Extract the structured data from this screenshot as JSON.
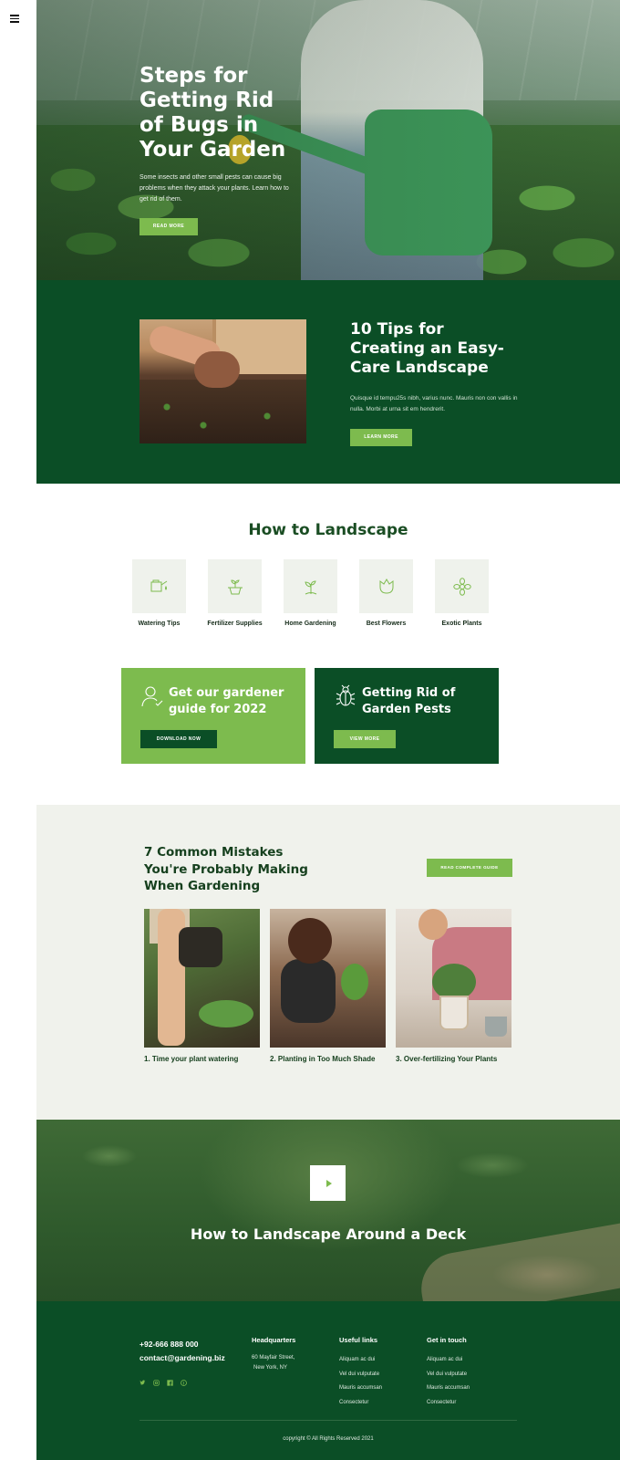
{
  "hero": {
    "title": "Steps for Getting Rid of Bugs in Your Garden",
    "text": "Some insects and other small pests can cause big problems when they attack your plants. Learn how to get rid of them.",
    "button": "READ MORE"
  },
  "tips": {
    "title": "10 Tips for Creating an Easy-Care Landscape",
    "text": "Quisque id tempu25s nibh, varius nunc. Mauris non con vallis in nulla. Morbi at urna sit em hendrerit.",
    "button": "LEARN MORE"
  },
  "howto": {
    "title": "How to Landscape",
    "categories": [
      {
        "label": "Watering Tips",
        "icon": "watering-can-icon"
      },
      {
        "label": "Fertilizer Supplies",
        "icon": "fertilizer-icon"
      },
      {
        "label": "Home Gardening",
        "icon": "sprout-icon"
      },
      {
        "label": "Best Flowers",
        "icon": "tulip-icon"
      },
      {
        "label": "Exotic Plants",
        "icon": "flower-icon"
      }
    ]
  },
  "promo": {
    "guide": {
      "title": "Get our gardener guide for 2022",
      "button": "DOWNLOAD NOW",
      "icon": "gardener-icon"
    },
    "pests": {
      "title": "Getting Rid of Garden Pests",
      "button": "VIEW MORE",
      "icon": "bug-icon"
    }
  },
  "mistakes": {
    "title": "7 Common Mistakes You're Probably Making When Gardening",
    "button": "READ COMPLETE GUIDE",
    "cards": [
      {
        "label": "1. Time your plant watering"
      },
      {
        "label": "2. Planting in Too Much Shade"
      },
      {
        "label": "3. Over-fertilizing Your Plants"
      }
    ]
  },
  "video": {
    "title": "How to Landscape Around a Deck"
  },
  "footer": {
    "phone": "+92-666 888 000",
    "email": "contact@gardening.biz",
    "socials": [
      "twitter-icon",
      "instagram-icon",
      "facebook-icon",
      "pinterest-icon"
    ],
    "headquarters": {
      "title": "Headquarters",
      "address": [
        "60 Mayfair Street,",
        "New York, NY"
      ]
    },
    "useful": {
      "title": "Useful links",
      "links": [
        "Aliquam ac dui",
        "Vel dui vulputate",
        "Mauris accumsan",
        "Consectetur"
      ]
    },
    "touch": {
      "title": "Get in touch",
      "links": [
        "Aliquam ac dui",
        "Vel dui vulputate",
        "Mauris accumsan",
        "Consectetur"
      ]
    },
    "copyright": "copyright © All Rights Reserved 2021"
  },
  "colors": {
    "dark_green": "#0b4e26",
    "light_green": "#7dbb4e",
    "pale_bg": "#f0f2ec"
  }
}
